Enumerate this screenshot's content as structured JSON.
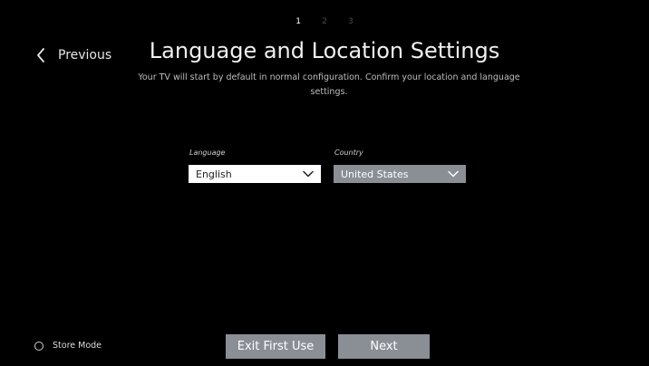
{
  "steps": [
    "1",
    "2",
    "3"
  ],
  "active_step": 0,
  "nav": {
    "previous_label": "Previous"
  },
  "header": {
    "title": "Language and Location Settings",
    "subtitle": "Your TV will start by default in normal configuration. Confirm your location and language settings."
  },
  "language": {
    "label": "Language",
    "value": "English"
  },
  "country": {
    "label": "Country",
    "value": "United States"
  },
  "footer": {
    "store_mode_label": "Store Mode",
    "store_mode_checked": false,
    "exit_label": "Exit First Use",
    "next_label": "Next"
  },
  "colors": {
    "background": "#000000",
    "button_gray": "#8a8f96",
    "dropdown_white": "#ffffff"
  },
  "icons": {
    "previous": "chevron-left-icon",
    "dropdown": "chevron-down-icon",
    "store_mode": "radio-icon"
  }
}
